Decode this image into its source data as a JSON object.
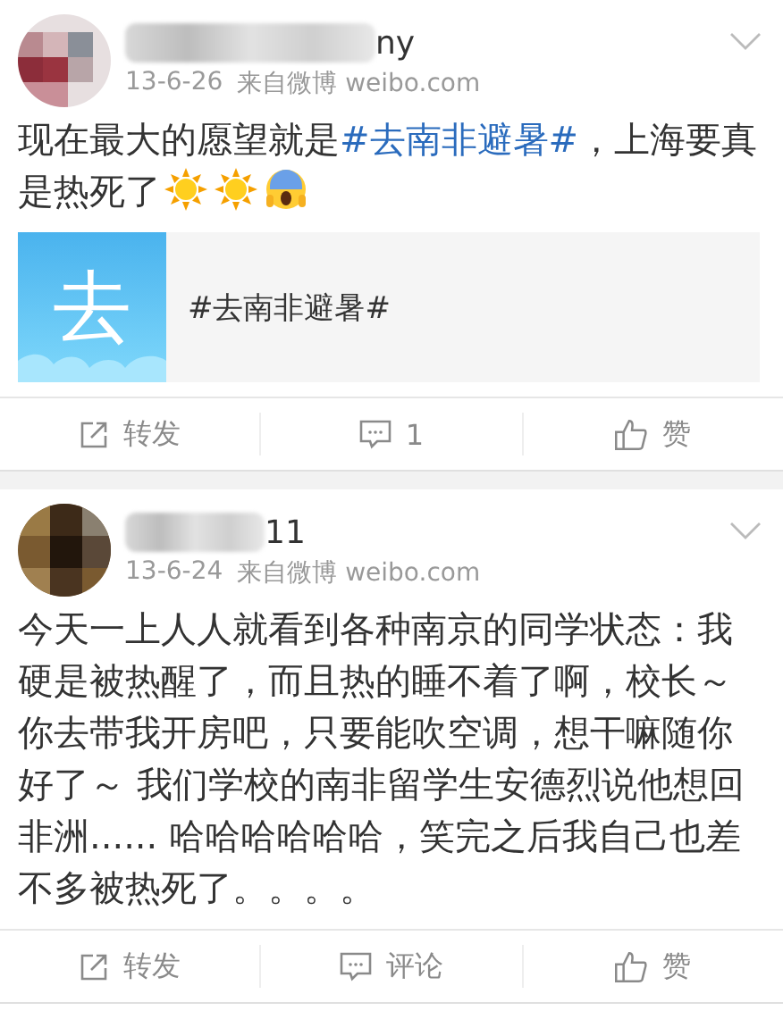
{
  "posts": [
    {
      "author_visible": "ny",
      "time": "13-6-26",
      "source": "来自微博 weibo.com",
      "body": [
        {
          "kind": "text",
          "text": "现在最大的愿望就是"
        },
        {
          "kind": "hashtag",
          "text": "#去南非避暑#"
        },
        {
          "kind": "text",
          "text": "，上海要真是热死了"
        },
        {
          "kind": "sun_emoji"
        },
        {
          "kind": "sun_emoji"
        },
        {
          "kind": "scream_emoji"
        }
      ],
      "card": {
        "thumb": "去",
        "title": "#去南非避暑#"
      },
      "actions": [
        {
          "kind": "repost",
          "label": "转发"
        },
        {
          "kind": "comment",
          "label": "1"
        },
        {
          "kind": "like",
          "label": "赞"
        }
      ]
    },
    {
      "author_visible": "11",
      "time": "13-6-24",
      "source": "来自微博 weibo.com",
      "body": [
        {
          "kind": "text",
          "text": "今天一上人人就看到各种南京的同学状态：我硬是被热醒了，而且热的睡不着了啊，校长～你去带我开房吧，只要能吹空调，想干嘛随你好了～ 我们学校的南非留学生安德烈说他想回非洲...... 哈哈哈哈哈哈，笑完之后我自己也差不多被热死了。。。。"
        }
      ],
      "actions": [
        {
          "kind": "repost",
          "label": "转发"
        },
        {
          "kind": "comment",
          "label": "评论"
        },
        {
          "kind": "like",
          "label": "赞"
        }
      ]
    }
  ]
}
